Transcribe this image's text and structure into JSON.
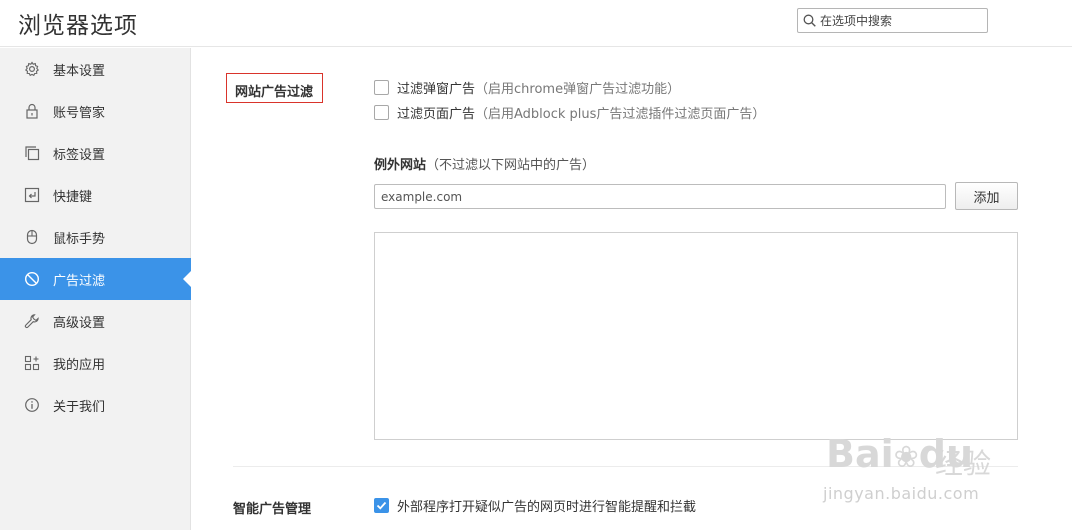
{
  "header": {
    "title": "浏览器选项",
    "search_placeholder": "在选项中搜索"
  },
  "sidebar": {
    "items": [
      {
        "label": "基本设置",
        "icon": "gear-icon"
      },
      {
        "label": "账号管家",
        "icon": "lock-icon"
      },
      {
        "label": "标签设置",
        "icon": "tabs-icon"
      },
      {
        "label": "快捷键",
        "icon": "keyboard-key-icon"
      },
      {
        "label": "鼠标手势",
        "icon": "mouse-icon"
      },
      {
        "label": "广告过滤",
        "icon": "block-icon",
        "active": true
      },
      {
        "label": "高级设置",
        "icon": "wrench-icon"
      },
      {
        "label": "我的应用",
        "icon": "apps-grid-icon"
      },
      {
        "label": "关于我们",
        "icon": "info-icon"
      }
    ]
  },
  "ad_filter": {
    "section_label": "网站广告过滤",
    "options": [
      {
        "label": "过滤弹窗广告",
        "hint": "（启用chrome弹窗广告过滤功能）",
        "checked": false
      },
      {
        "label": "过滤页面广告",
        "hint": "（启用Adblock plus广告过滤插件过滤页面广告）",
        "checked": false
      }
    ],
    "exception_title": "例外网站",
    "exception_hint": "（不过滤以下网站中的广告）",
    "site_input_placeholder": "example.com",
    "add_button": "添加"
  },
  "smart_ad": {
    "section_label": "智能广告管理",
    "option_label": "外部程序打开疑似广告的网页时进行智能提醒和拦截",
    "checked": true
  },
  "watermark": {
    "brand": "Bai",
    "brand_suffix": "du",
    "cn": "经验",
    "url": "jingyan.baidu.com"
  },
  "colors": {
    "accent": "#3b93e8",
    "highlight_border": "#d9342b"
  }
}
